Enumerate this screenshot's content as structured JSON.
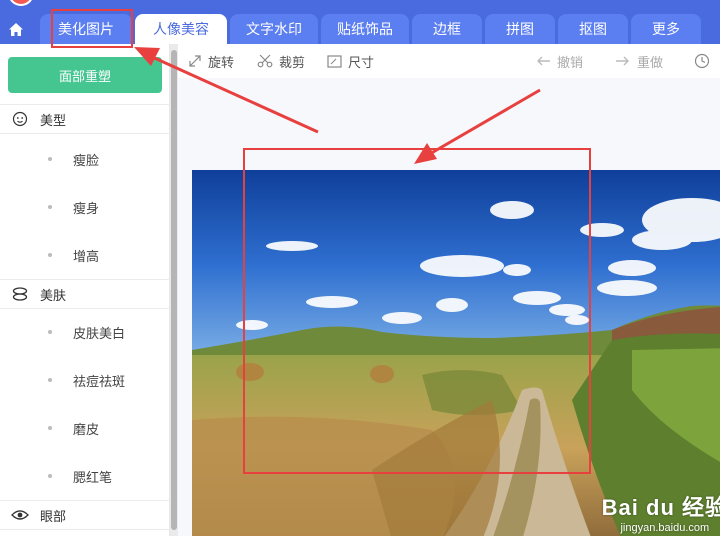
{
  "tabs": [
    {
      "label": "美化图片",
      "active": false
    },
    {
      "label": "人像美容",
      "active": true
    },
    {
      "label": "文字水印",
      "active": false
    },
    {
      "label": "贴纸饰品",
      "active": false
    },
    {
      "label": "边框",
      "active": false
    },
    {
      "label": "拼图",
      "active": false
    },
    {
      "label": "抠图",
      "active": false
    },
    {
      "label": "更多",
      "active": false
    }
  ],
  "sidebar": {
    "face_button": "面部重塑",
    "sections": [
      {
        "label": "美型",
        "icon": "face-icon",
        "items": [
          "瘦脸",
          "瘦身",
          "增高"
        ]
      },
      {
        "label": "美肤",
        "icon": "skin-icon",
        "items": [
          "皮肤美白",
          "祛痘祛斑",
          "磨皮",
          "腮红笔"
        ]
      },
      {
        "label": "眼部",
        "icon": "eye-icon",
        "items": []
      }
    ]
  },
  "toolbar": {
    "rotate": "旋转",
    "crop": "裁剪",
    "size": "尺寸",
    "undo": "撤销",
    "redo": "重做"
  },
  "watermark": {
    "line1": "Bai du 经验",
    "line2": "jingyan.baidu.com"
  },
  "colors": {
    "tab_bar": "#4a6be0",
    "tab": "#5b7ef0",
    "accent_green": "#45c690",
    "annotation_red": "#e8403f"
  }
}
